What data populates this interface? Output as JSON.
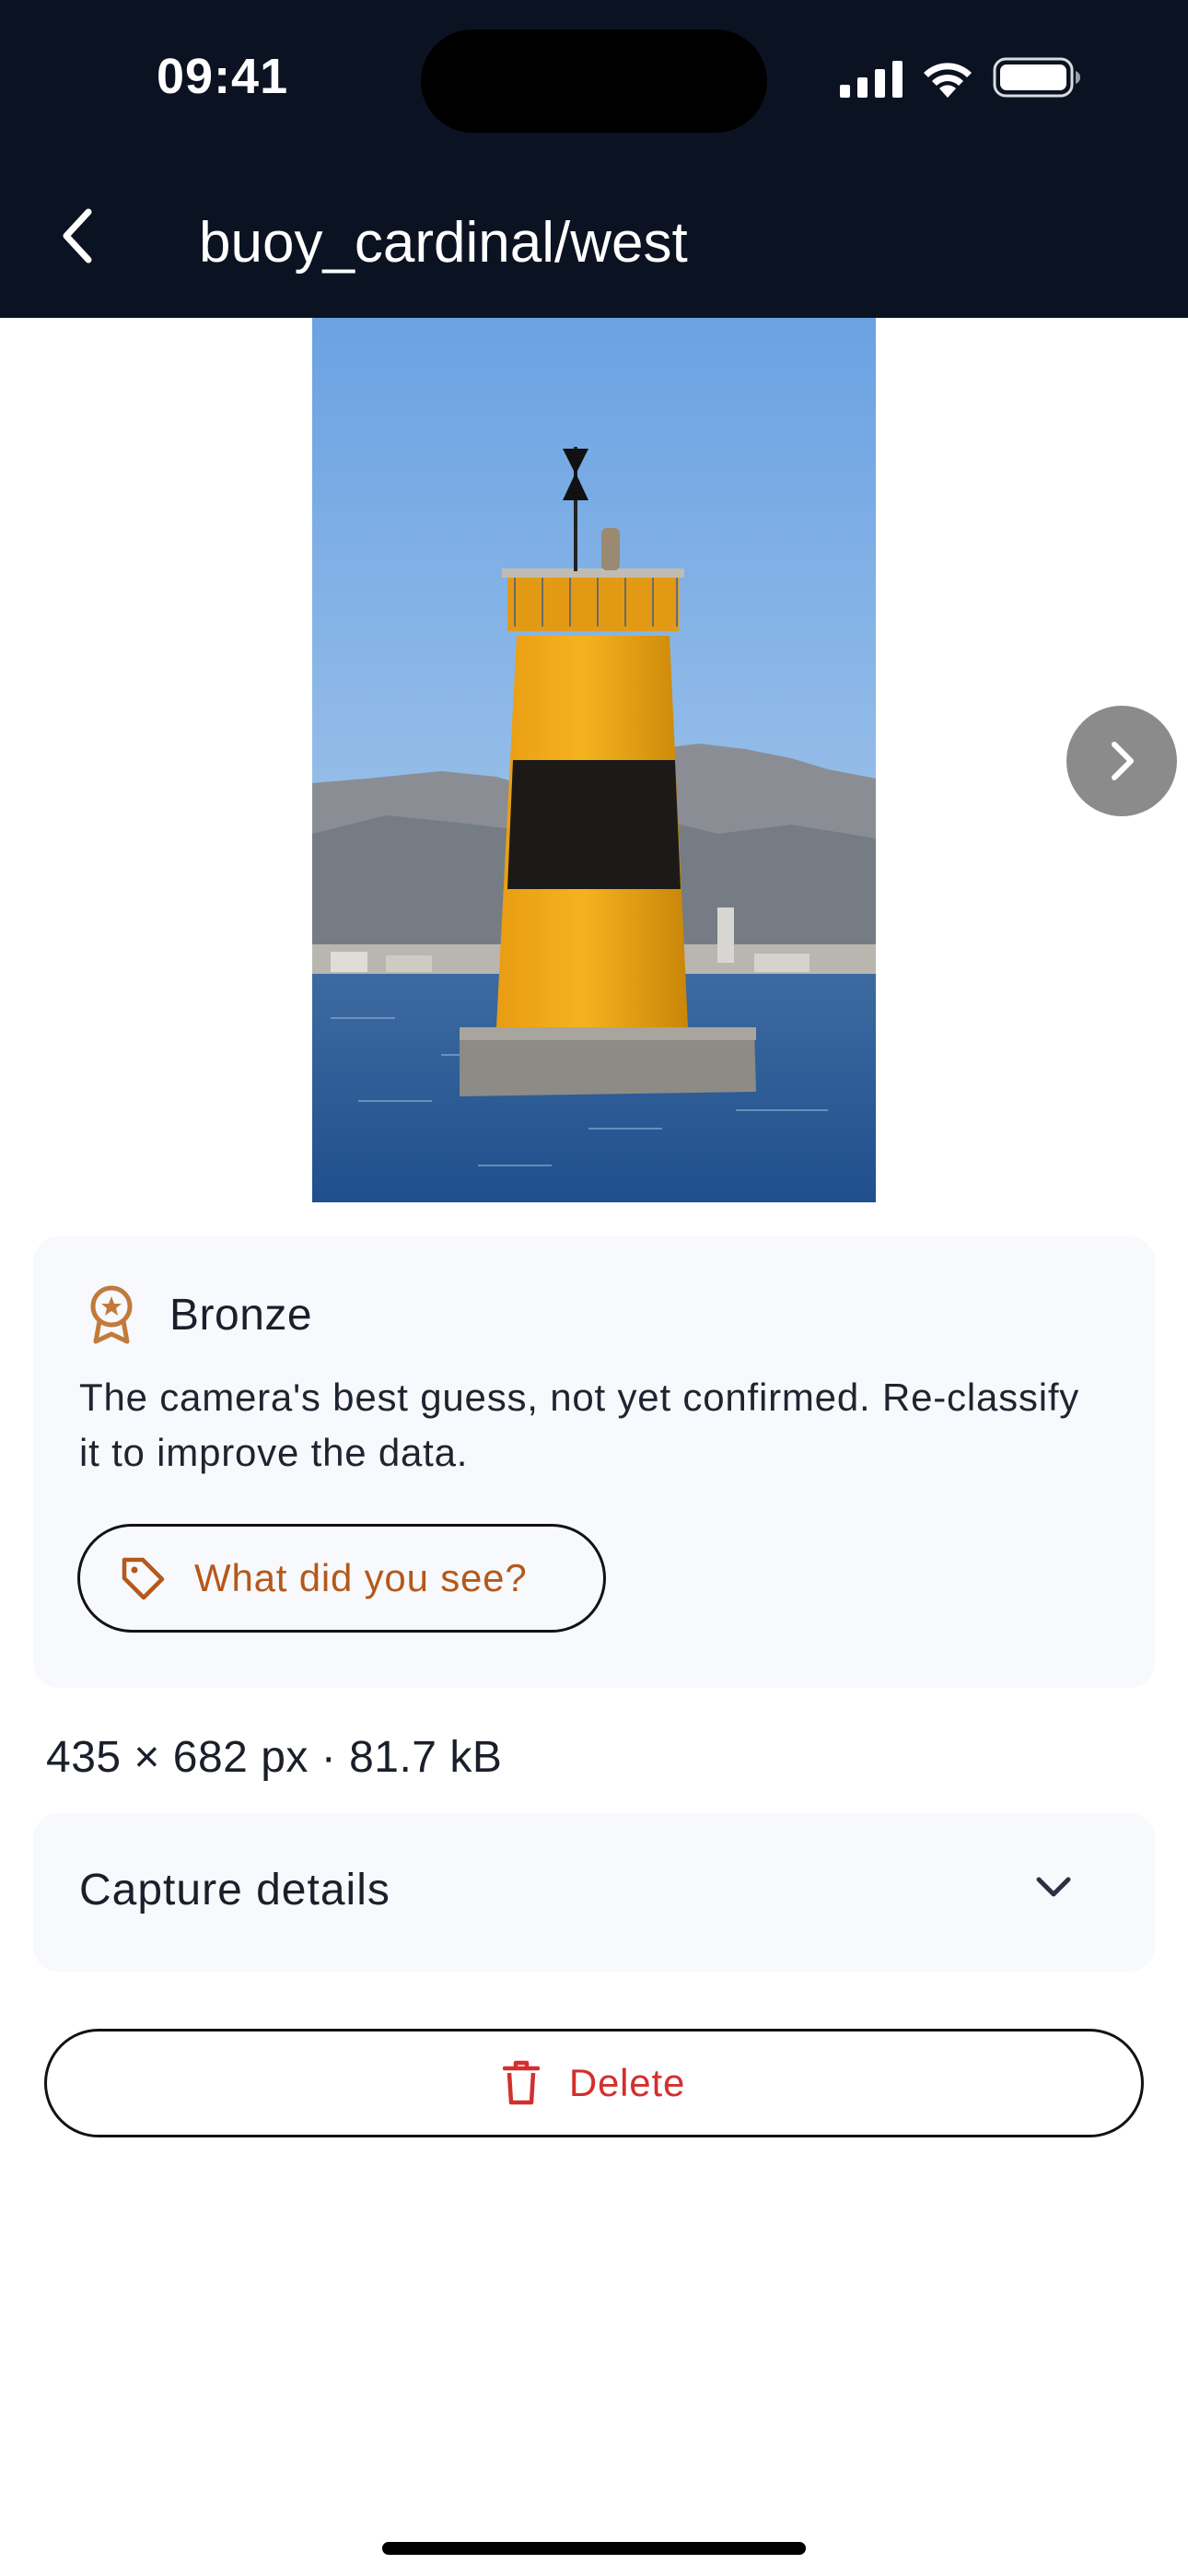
{
  "status_bar": {
    "time": "09:41"
  },
  "nav": {
    "title": "buoy_cardinal/west",
    "back_icon": "chevron-left-icon"
  },
  "photo": {
    "subject": "west cardinal buoy tower, yellow with black band",
    "next_icon": "chevron-right-icon"
  },
  "classification": {
    "tier": "Bronze",
    "tier_icon": "award-medal-icon",
    "tier_color": "#c27a3c",
    "description": "The camera's best guess, not yet confirmed. Re-classify it to improve the data.",
    "action_label": "What did you see?",
    "action_icon": "tag-icon",
    "accent": "#b5581a"
  },
  "file_info": {
    "summary": "435 × 682 px · 81.7 kB"
  },
  "capture_details": {
    "label": "Capture details",
    "icon": "chevron-down-icon"
  },
  "delete": {
    "label": "Delete",
    "icon": "trash-icon",
    "color": "#d32f2f"
  },
  "colors": {
    "header_bg": "#0b1222",
    "card_bg": "#f7f9fc"
  }
}
